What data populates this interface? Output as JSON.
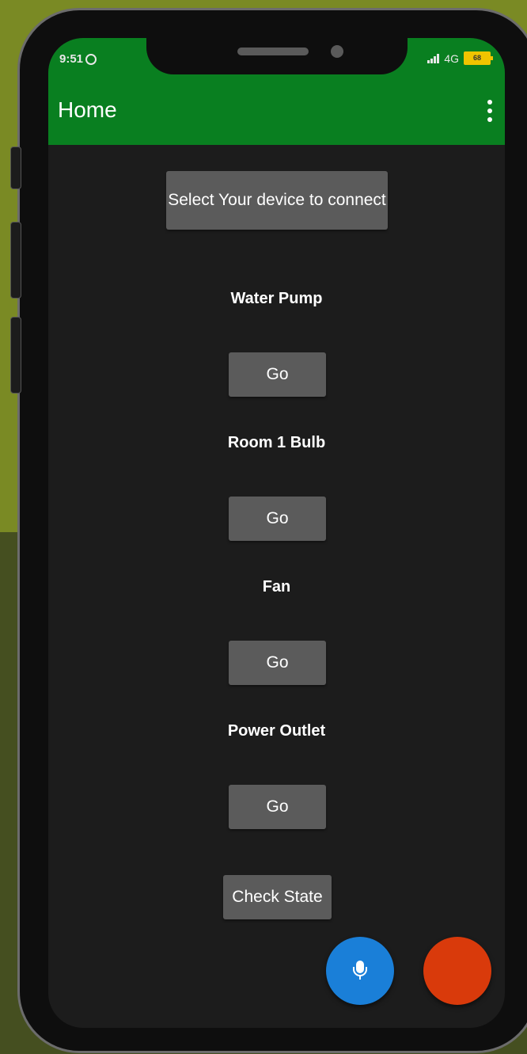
{
  "status_bar": {
    "time": "9:51",
    "network": "4G",
    "battery": "68"
  },
  "app_bar": {
    "title": "Home"
  },
  "connect_button": "Select Your device to connect",
  "devices": [
    {
      "name": "Water Pump",
      "button": "Go"
    },
    {
      "name": "Room 1 Bulb",
      "button": "Go"
    },
    {
      "name": "Fan",
      "button": "Go"
    },
    {
      "name": "Power Outlet",
      "button": "Go"
    }
  ],
  "check_state_button": "Check State",
  "colors": {
    "app_bar": "#097f20",
    "screen_bg": "#1c1c1c",
    "button": "#5b5b5b",
    "mic_fab": "#1a7fd8",
    "red_fab": "#d93a0b"
  },
  "icons": {
    "mic": "microphone-icon",
    "menu": "overflow-menu-icon"
  }
}
